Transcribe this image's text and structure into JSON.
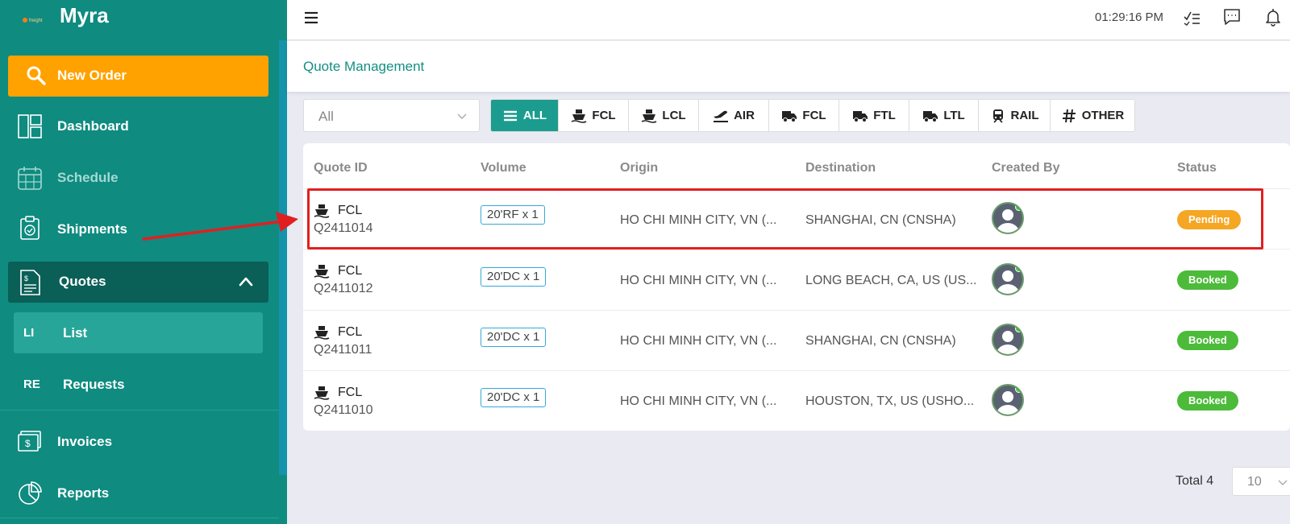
{
  "app": {
    "name": "Myra",
    "logo_text": "freight"
  },
  "sidebar": {
    "new_order": "New Order",
    "items": [
      {
        "label": "Dashboard"
      },
      {
        "label": "Schedule"
      },
      {
        "label": "Shipments"
      },
      {
        "label": "Quotes"
      },
      {
        "label": "Invoices"
      },
      {
        "label": "Reports"
      }
    ],
    "sub_items": [
      {
        "abbr": "LI",
        "label": "List"
      },
      {
        "abbr": "RE",
        "label": "Requests"
      }
    ]
  },
  "header": {
    "time": "01:29:16 PM"
  },
  "page": {
    "title": "Quote Management"
  },
  "filters": {
    "select_value": "All",
    "tabs": [
      "ALL",
      "FCL",
      "LCL",
      "AIR",
      "FCL",
      "FTL",
      "LTL",
      "RAIL",
      "OTHER"
    ],
    "active_tab": "ALL"
  },
  "table": {
    "columns": [
      "Quote ID",
      "Volume",
      "Origin",
      "Destination",
      "Created By",
      "Status"
    ],
    "rows": [
      {
        "mode": "FCL",
        "id": "Q2411014",
        "volume": "20'RF x 1",
        "origin": "HO CHI MINH CITY, VN (...",
        "destination": "SHANGHAI, CN (CNSHA)",
        "status": "Pending"
      },
      {
        "mode": "FCL",
        "id": "Q2411012",
        "volume": "20'DC x 1",
        "origin": "HO CHI MINH CITY, VN (...",
        "destination": "LONG BEACH, CA, US (US...",
        "status": "Booked"
      },
      {
        "mode": "FCL",
        "id": "Q2411011",
        "volume": "20'DC x 1",
        "origin": "HO CHI MINH CITY, VN (...",
        "destination": "SHANGHAI, CN (CNSHA)",
        "status": "Booked"
      },
      {
        "mode": "FCL",
        "id": "Q2411010",
        "volume": "20'DC x 1",
        "origin": "HO CHI MINH CITY, VN (...",
        "destination": "HOUSTON, TX, US (USHO...",
        "status": "Booked"
      }
    ]
  },
  "pagination": {
    "total_label": "Total 4",
    "page_size": "10"
  },
  "colors": {
    "sidebar": "#0f8b80",
    "accent": "#ffa200",
    "pending": "#f5a623",
    "booked": "#4cbb3a",
    "annotation": "#e02020"
  }
}
